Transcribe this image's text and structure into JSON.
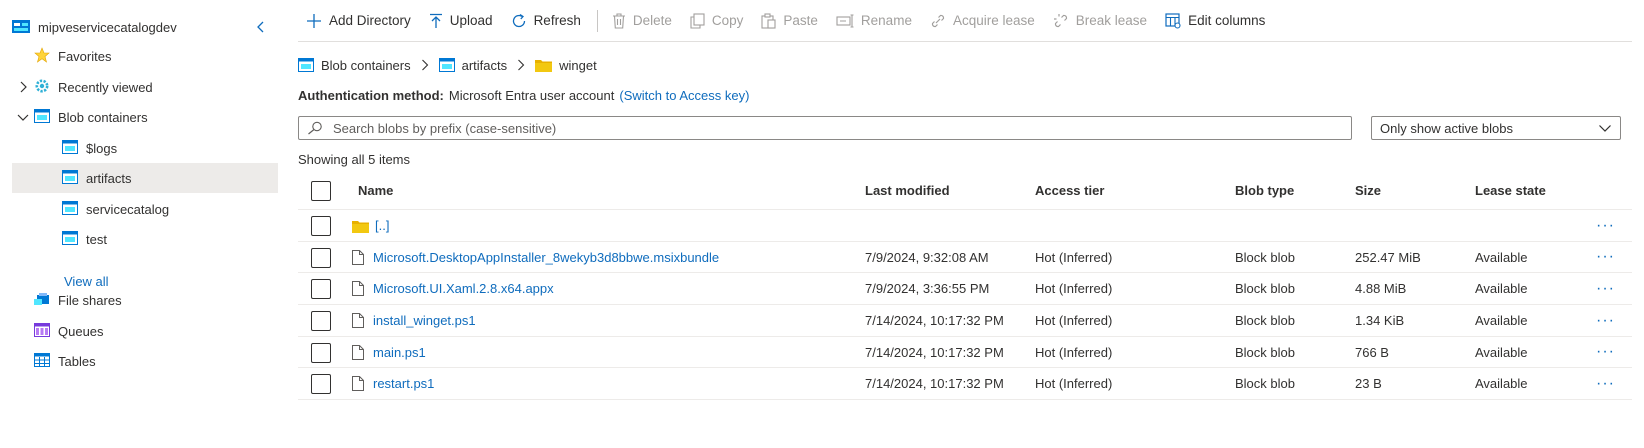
{
  "sidebar": {
    "account": "mipveservicecatalogdev",
    "items": [
      {
        "label": "Favorites"
      },
      {
        "label": "Recently viewed"
      },
      {
        "label": "Blob containers"
      },
      {
        "label": "$logs"
      },
      {
        "label": "artifacts"
      },
      {
        "label": "servicecatalog"
      },
      {
        "label": "test"
      }
    ],
    "view_all": "View all",
    "bottom_items": [
      {
        "label": "File shares"
      },
      {
        "label": "Queues"
      },
      {
        "label": "Tables"
      }
    ]
  },
  "toolbar": {
    "add_directory": "Add Directory",
    "upload": "Upload",
    "refresh": "Refresh",
    "delete": "Delete",
    "copy": "Copy",
    "paste": "Paste",
    "rename": "Rename",
    "acquire_lease": "Acquire lease",
    "break_lease": "Break lease",
    "edit_columns": "Edit columns"
  },
  "breadcrumb": [
    "Blob containers",
    "artifacts",
    "winget"
  ],
  "auth": {
    "label": "Authentication method:",
    "value": "Microsoft Entra user account",
    "switch_link": "(Switch to Access key)"
  },
  "search": {
    "placeholder": "Search blobs by prefix (case-sensitive)"
  },
  "filter": {
    "selected": "Only show active blobs"
  },
  "showing": "Showing all 5 items",
  "table": {
    "headers": {
      "name": "Name",
      "last_modified": "Last modified",
      "access_tier": "Access tier",
      "blob_type": "Blob type",
      "size": "Size",
      "lease_state": "Lease state"
    },
    "parent_row": "[..]",
    "more_label": "···",
    "rows": [
      {
        "name": "Microsoft.DesktopAppInstaller_8wekyb3d8bbwe.msixbundle",
        "last_modified": "7/9/2024, 9:32:08 AM",
        "access_tier": "Hot (Inferred)",
        "blob_type": "Block blob",
        "size": "252.47 MiB",
        "lease_state": "Available"
      },
      {
        "name": "Microsoft.UI.Xaml.2.8.x64.appx",
        "last_modified": "7/9/2024, 3:36:55 PM",
        "access_tier": "Hot (Inferred)",
        "blob_type": "Block blob",
        "size": "4.88 MiB",
        "lease_state": "Available"
      },
      {
        "name": "install_winget.ps1",
        "last_modified": "7/14/2024, 10:17:32 PM",
        "access_tier": "Hot (Inferred)",
        "blob_type": "Block blob",
        "size": "1.34 KiB",
        "lease_state": "Available"
      },
      {
        "name": "main.ps1",
        "last_modified": "7/14/2024, 10:17:32 PM",
        "access_tier": "Hot (Inferred)",
        "blob_type": "Block blob",
        "size": "766 B",
        "lease_state": "Available"
      },
      {
        "name": "restart.ps1",
        "last_modified": "7/14/2024, 10:17:32 PM",
        "access_tier": "Hot (Inferred)",
        "blob_type": "Block blob",
        "size": "23 B",
        "lease_state": "Available"
      }
    ]
  },
  "colors": {
    "accent": "#0f6cbd",
    "selected_bg": "#edebe9",
    "folder": "#f2c811",
    "disabled": "#a19f9d"
  }
}
